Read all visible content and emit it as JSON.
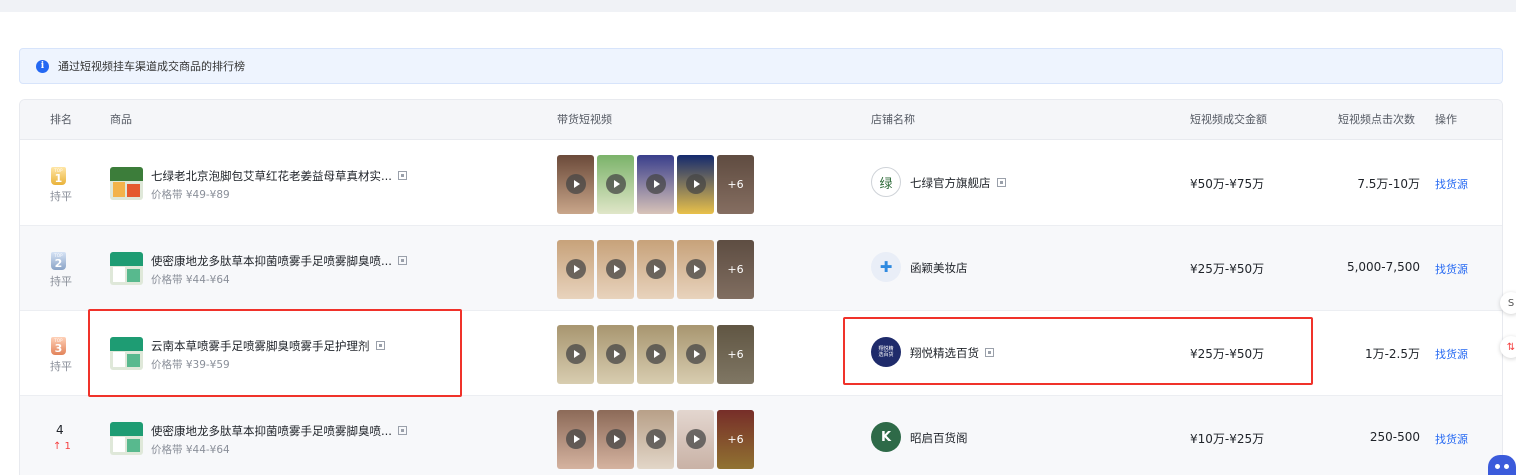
{
  "notice": {
    "text": "通过短视频挂车渠道成交商品的排行榜"
  },
  "columns": {
    "rank": "排名",
    "product": "商品",
    "videos": "带货短视频",
    "shop": "店铺名称",
    "gmv": "短视频成交金额",
    "clicks": "短视频点击次数",
    "action": "操作"
  },
  "rows": [
    {
      "rank": "1",
      "badge_top": "TOP",
      "trend": "持平",
      "title": "七绿老北京泡脚包艾草红花老姜益母草真材实...",
      "price": "价格带 ¥49-¥89",
      "more": "+6",
      "shop": "七绿官方旗舰店",
      "gmv": "¥50万-¥75万",
      "clicks": "7.5万-10万",
      "action": "找货源"
    },
    {
      "rank": "2",
      "badge_top": "TOP",
      "trend": "持平",
      "title": "使密康地龙多肽草本抑菌喷雾手足喷雾脚臭喷...",
      "price": "价格带 ¥44-¥64",
      "more": "+6",
      "shop": "函颖美妆店",
      "gmv": "¥25万-¥50万",
      "clicks": "5,000-7,500",
      "action": "找货源"
    },
    {
      "rank": "3",
      "badge_top": "TOP",
      "trend": "持平",
      "title": "云南本草喷雾手足喷雾脚臭喷雾手足护理剂",
      "price": "价格带 ¥39-¥59",
      "more": "+6",
      "shop": "翔悦精选百货",
      "gmv": "¥25万-¥50万",
      "clicks": "1万-2.5万",
      "action": "找货源"
    },
    {
      "rank": "4",
      "trend": "↑ 1",
      "title": "使密康地龙多肽草本抑菌喷雾手足喷雾脚臭喷...",
      "price": "价格带 ¥44-¥64",
      "more": "+6",
      "shop": "昭启百货阁",
      "gmv": "¥10万-¥25万",
      "clicks": "250-500",
      "action": "找货源"
    }
  ],
  "shop_logos": {
    "row1": "绿",
    "row3": "翔悦精选百货",
    "row4": "K"
  },
  "colors": {
    "accent": "#2468f2",
    "highlight": "#f0322a",
    "trend_up": "#f53f3f"
  },
  "icons": [
    "info-icon",
    "qr-code-icon",
    "play-icon",
    "chatbot-icon"
  ]
}
